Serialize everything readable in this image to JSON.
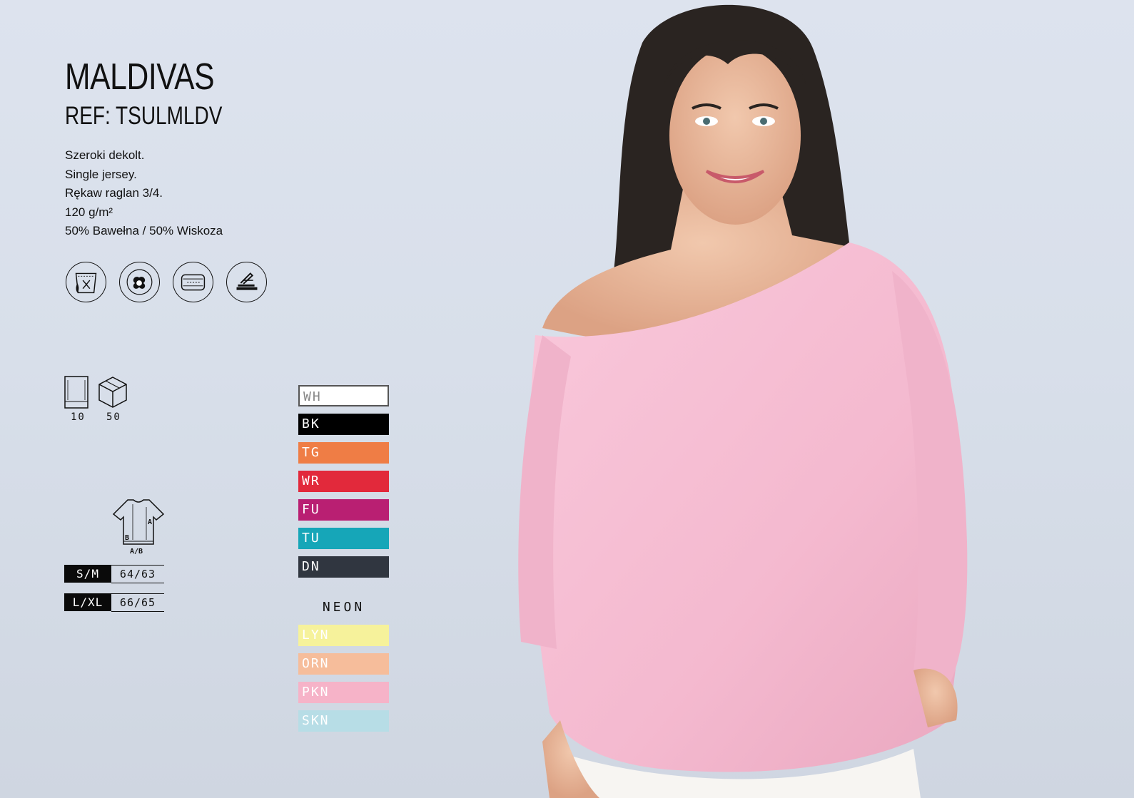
{
  "product": {
    "name": "MALDIVAS",
    "ref": "REF: TSULMLDV",
    "features": [
      "Szeroki dekolt.",
      "Single jersey.",
      "Rękaw raglan 3/4.",
      "120 g/m²",
      "50% Bawełna / 50% Wiskoza"
    ]
  },
  "care_icons": [
    "no-bleach-wash-icon",
    "cotton-icon",
    "sublimation-print-icon",
    "heat-press-icon"
  ],
  "packaging": [
    {
      "icon": "polybag-icon",
      "quantity": "10"
    },
    {
      "icon": "box-icon",
      "quantity": "50"
    }
  ],
  "size_table": {
    "diagram_labels": {
      "a": "A",
      "b": "B",
      "ab": "A/B"
    },
    "rows": [
      {
        "size": "S/M",
        "value": "64/63"
      },
      {
        "size": "L/XL",
        "value": "66/65"
      }
    ]
  },
  "colors": [
    {
      "code": "WH",
      "color": "#ffffff",
      "text": "#888888"
    },
    {
      "code": "BK",
      "color": "#000000",
      "text": "#ffffff"
    },
    {
      "code": "TG",
      "color": "#ef7d45",
      "text": "#ffffff"
    },
    {
      "code": "WR",
      "color": "#e2293b",
      "text": "#ffffff"
    },
    {
      "code": "FU",
      "color": "#b91f72",
      "text": "#ffffff"
    },
    {
      "code": "TU",
      "color": "#16a6b8",
      "text": "#ffffff"
    },
    {
      "code": "DN",
      "color": "#303640",
      "text": "#ffffff"
    }
  ],
  "neon_label": "NEON",
  "neon_colors": [
    {
      "code": "LYN",
      "color": "#f6f29b",
      "text": "#ffffff"
    },
    {
      "code": "ORN",
      "color": "#f6bd9b",
      "text": "#ffffff"
    },
    {
      "code": "PKN",
      "color": "#f6b3c8",
      "text": "#ffffff"
    },
    {
      "code": "SKN",
      "color": "#b7dde6",
      "text": "#ffffff"
    }
  ]
}
